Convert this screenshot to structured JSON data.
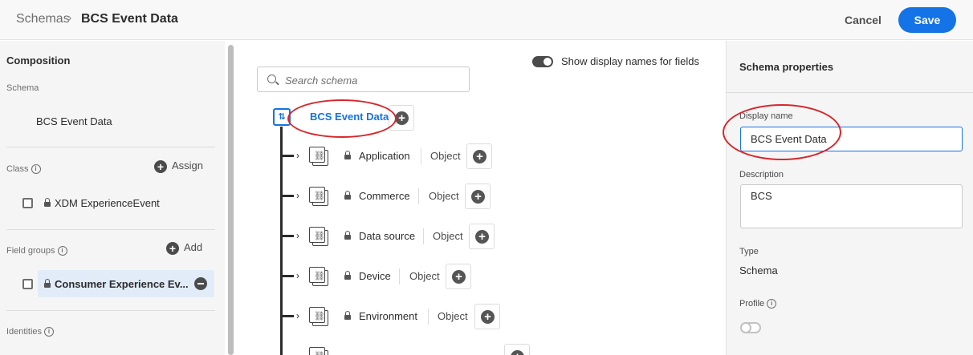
{
  "header": {
    "breadcrumb_root": "Schemas",
    "breadcrumb_sep": "›",
    "breadcrumb_current": "BCS Event Data",
    "cancel_label": "Cancel",
    "save_label": "Save",
    "accent": "#1473e6"
  },
  "composition": {
    "title": "Composition",
    "schema_label": "Schema",
    "schema_value": "BCS Event Data",
    "class_label": "Class",
    "assign_label": "Assign",
    "class_value": "XDM ExperienceEvent",
    "field_groups_label": "Field groups",
    "add_label": "Add",
    "field_group_value": "Consumer Experience Ev...",
    "identities_label": "Identities"
  },
  "canvas": {
    "toggle_label": "Show display names for fields",
    "search_placeholder": "Search schema",
    "root_name": "BCS Event Data",
    "fields": [
      {
        "name": "Application",
        "type": "Object"
      },
      {
        "name": "Commerce",
        "type": "Object"
      },
      {
        "name": "Data source",
        "type": "Object"
      },
      {
        "name": "Device",
        "type": "Object"
      },
      {
        "name": "Environment",
        "type": "Object"
      }
    ]
  },
  "properties": {
    "title": "Schema properties",
    "display_name_label": "Display name",
    "display_name_value": "BCS Event Data",
    "description_label": "Description",
    "description_value": "BCS",
    "type_label": "Type",
    "type_value": "Schema",
    "profile_label": "Profile"
  },
  "icons": {
    "chevron": "chevron-right-icon",
    "object": "object-link-icon",
    "lock": "lock-icon",
    "add": "add-circle-icon",
    "remove": "remove-circle-icon",
    "info": "info-icon",
    "search": "search-icon"
  },
  "annotation_color": "#d7262b"
}
